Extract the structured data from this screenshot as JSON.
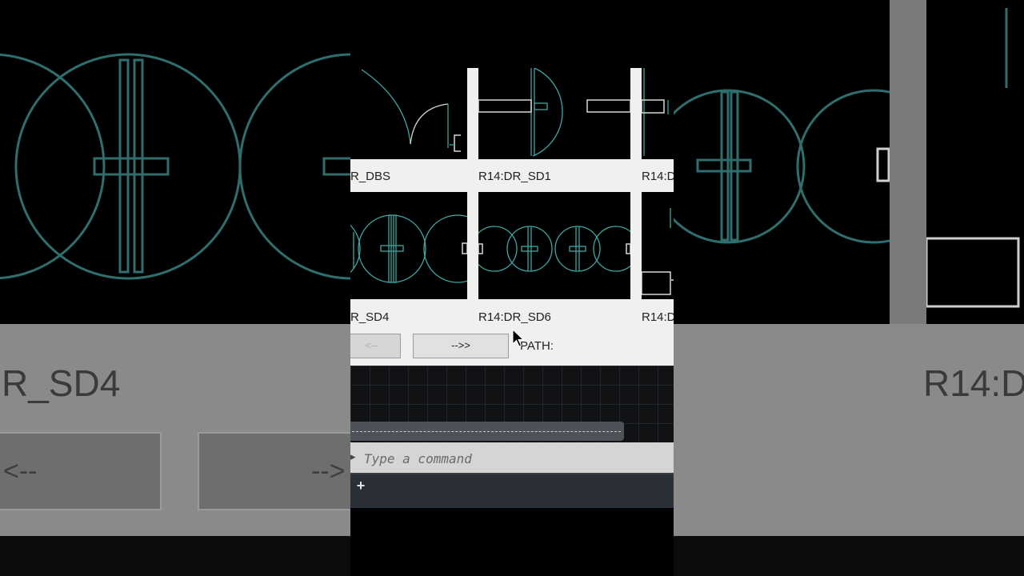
{
  "palette": {
    "row1_labels": [
      "R_DBS",
      "R14:DR_SD1",
      "R14:D"
    ],
    "row2_labels": [
      "R_SD4",
      "R14:DR_SD6",
      "R14:D"
    ],
    "prev_button": "<--",
    "next_button": "-->>",
    "path_label": "PATH:"
  },
  "command_line": {
    "placeholder": "Type a command",
    "prompt_icon": "▸"
  },
  "tabbar": {
    "add_label": "+"
  },
  "backdrop": {
    "left_label": "R_SD4",
    "left_button": "<--",
    "left_button_right": "-->",
    "right_label": "R14:D"
  },
  "colors": {
    "symbol_line": "#3fa7a3",
    "symbol_white": "#d8d8d8",
    "palette_bg": "#f0f0ee"
  },
  "icons": [
    "cursor-arrow-icon",
    "add-tab-icon",
    "command-prompt-icon"
  ]
}
